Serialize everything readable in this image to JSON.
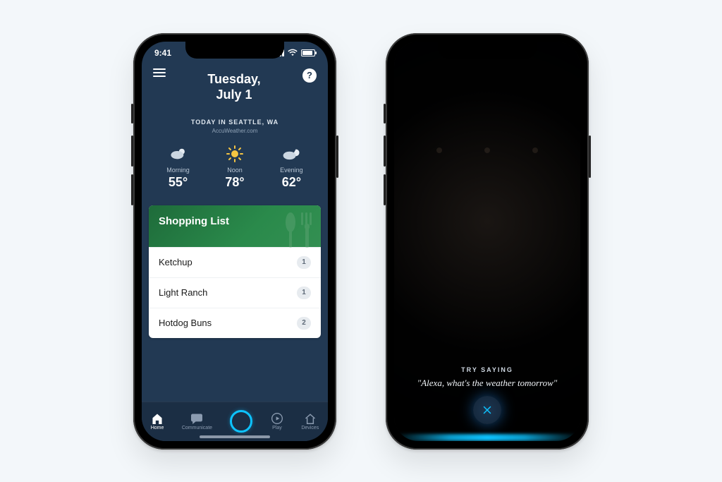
{
  "status": {
    "time": "9:41"
  },
  "header": {
    "date_line1": "Tuesday,",
    "date_line2": "July 1",
    "today_line": "TODAY IN SEATTLE, WA",
    "provider": "AccuWeather.com"
  },
  "weather": {
    "cols": [
      {
        "label": "Morning",
        "temp": "55°"
      },
      {
        "label": "Noon",
        "temp": "78°"
      },
      {
        "label": "Evening",
        "temp": "62°"
      }
    ]
  },
  "shopping": {
    "title": "Shopping List",
    "items": [
      {
        "name": "Ketchup",
        "count": "1"
      },
      {
        "name": "Light Ranch",
        "count": "1"
      },
      {
        "name": "Hotdog Buns",
        "count": "2"
      }
    ]
  },
  "nav": {
    "home": "Home",
    "communicate": "Communicate",
    "play": "Play",
    "devices": "Devices"
  },
  "voice": {
    "try_label": "TRY SAYING",
    "prompt": "\"Alexa, what's the weather tomorrow\""
  }
}
